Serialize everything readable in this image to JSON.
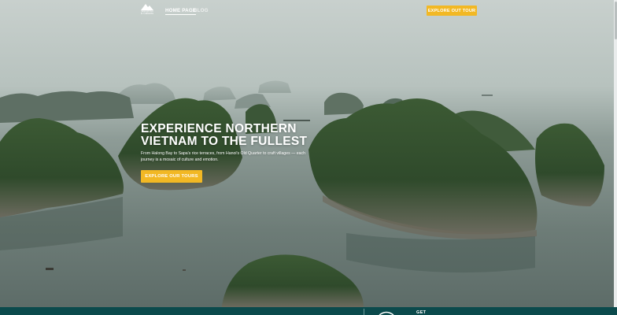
{
  "nav": {
    "logo_text": [
      "Wonderful",
      "& Cultures"
    ],
    "links": [
      {
        "label": "HOME PAGE",
        "active": true
      },
      {
        "label": "BLOG",
        "active": false
      }
    ],
    "explore_label": "EXPLORE OUT TOUR"
  },
  "hero": {
    "title": "EXPERIENCE NORTHERN\nVIETNAM  TO THE FULLEST",
    "description": "From Halong Bay to Sapa's rice terraces, from Hanoi's Old Quarter to craft villages — each journey is a mosaic of culture and emotion.",
    "cta_label": "EXPLORE OUR TOURS",
    "image": "ha-long-bay-karst-islands"
  },
  "footer": {
    "label": "GET"
  },
  "colors": {
    "accent": "#f2b824",
    "footer_bg": "#0b4a4c",
    "water": "#6f807b",
    "sky": "#c5cdca"
  }
}
